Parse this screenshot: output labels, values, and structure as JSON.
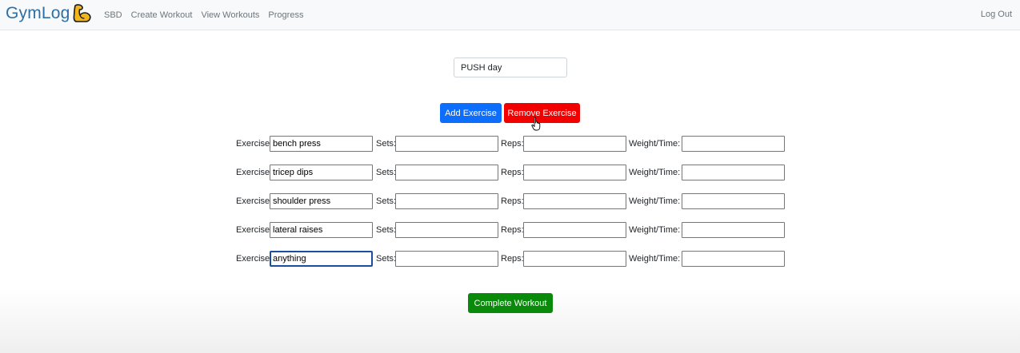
{
  "navbar": {
    "brand": "GymLog",
    "brand_icon": "flexed-biceps-icon",
    "links": [
      "SBD",
      "Create Workout",
      "View Workouts",
      "Progress"
    ],
    "logout": "Log Out"
  },
  "workout": {
    "name_value": "PUSH day"
  },
  "buttons": {
    "add": "Add Exercise",
    "remove": "Remove Exercise",
    "complete": "Complete Workout"
  },
  "labels": {
    "exercise": "Exercise:",
    "sets": "Sets:",
    "reps": "Reps:",
    "weight": "Weight/Time:"
  },
  "exercises": [
    {
      "name": "bench press",
      "sets": "",
      "reps": "",
      "weight": ""
    },
    {
      "name": "tricep dips",
      "sets": "",
      "reps": "",
      "weight": ""
    },
    {
      "name": "shoulder press",
      "sets": "",
      "reps": "",
      "weight": ""
    },
    {
      "name": "lateral raises",
      "sets": "",
      "reps": "",
      "weight": ""
    },
    {
      "name": "anything",
      "sets": "",
      "reps": "",
      "weight": ""
    }
  ],
  "colors": {
    "brand_blue": "#2f6fa3",
    "add_button": "#0d6efd",
    "remove_button": "#f20000",
    "complete_button": "#0a8a0a"
  }
}
